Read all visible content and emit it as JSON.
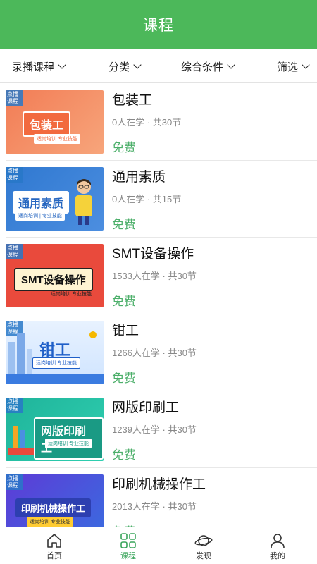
{
  "header": {
    "title": "课程"
  },
  "filters": [
    {
      "label": "录播课程"
    },
    {
      "label": "分类"
    },
    {
      "label": "综合条件"
    },
    {
      "label": "筛选"
    }
  ],
  "courses": [
    {
      "title": "包装工",
      "meta": "0人在学 · 共30节",
      "price": "免费",
      "thumb_tag": "点播课程",
      "thumb_banner": "包装工",
      "thumb_sub": "适岗培训 专业技能"
    },
    {
      "title": "通用素质",
      "meta": "0人在学 · 共15节",
      "price": "免费",
      "thumb_tag": "点播课程",
      "thumb_banner": "通用素质",
      "thumb_sub": "适岗培训 | 专业技能"
    },
    {
      "title": "SMT设备操作",
      "meta": "1533人在学 · 共30节",
      "price": "免费",
      "thumb_tag": "点播课程",
      "thumb_banner": "SMT设备操作",
      "thumb_sub": "适岗培训 专业技能"
    },
    {
      "title": "钳工",
      "meta": "1266人在学 · 共30节",
      "price": "免费",
      "thumb_tag": "点播课程",
      "thumb_banner": "钳工",
      "thumb_sub": "适岗培训 专业技能"
    },
    {
      "title": "网版印刷工",
      "meta": "1239人在学 · 共30节",
      "price": "免费",
      "thumb_tag": "点播课程",
      "thumb_banner": "网版印刷工",
      "thumb_sub": "适岗培训 专业技能"
    },
    {
      "title": "印刷机械操作工",
      "meta": "2013人在学 · 共30节",
      "price": "免费",
      "thumb_tag": "点播课程",
      "thumb_banner": "印刷机械操作工",
      "thumb_sub": "适岗培训 专业技能"
    }
  ],
  "tabs": [
    {
      "label": "首页",
      "icon": "home-icon"
    },
    {
      "label": "课程",
      "icon": "course-grid-icon"
    },
    {
      "label": "发现",
      "icon": "planet-icon"
    },
    {
      "label": "我的",
      "icon": "person-icon"
    }
  ],
  "colors": {
    "accent": "#4cb85a",
    "price": "#4caf6a"
  }
}
